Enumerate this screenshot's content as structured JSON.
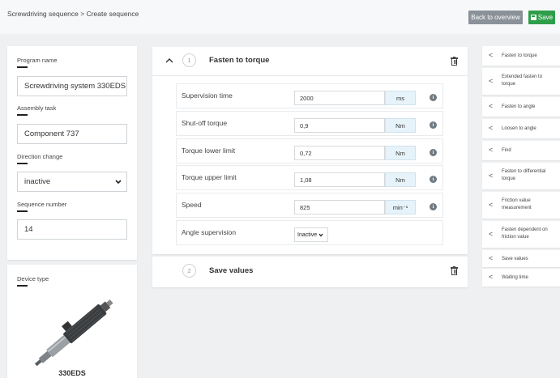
{
  "header": {
    "breadcrumb": "Screwdriving sequence > Create sequence",
    "back_label": "Back to overview",
    "save_label": "Save"
  },
  "program": {
    "program_name_label": "Program name",
    "program_name_value": "Screwdriving system 330EDS",
    "assembly_task_label": "Assembly task",
    "assembly_task_value": "Component 737",
    "direction_change_label": "Direction change",
    "direction_change_value": "inactive",
    "sequence_number_label": "Sequence number",
    "sequence_number_value": "14"
  },
  "device": {
    "label": "Device type",
    "name": "330EDS"
  },
  "steps": [
    {
      "number": "1",
      "title": "Fasten to torque"
    },
    {
      "number": "2",
      "title": "Save values"
    }
  ],
  "params": [
    {
      "label": "Supervision time",
      "value": "2000",
      "unit": "ms"
    },
    {
      "label": "Shut-off torque",
      "value": "0,9",
      "unit": "Nm"
    },
    {
      "label": "Torque lower limit",
      "value": "0,72",
      "unit": "Nm"
    },
    {
      "label": "Torque upper limit",
      "value": "1,08",
      "unit": "Nm"
    },
    {
      "label": "Speed",
      "value": "825",
      "unit": "min⁻¹"
    },
    {
      "label": "Angle supervision",
      "value": "Inactive"
    }
  ],
  "sidebar": {
    "items": [
      {
        "label_lines": [
          "Fasten to torque"
        ]
      },
      {
        "label_lines": [
          "Extended fasten to",
          "torque"
        ]
      },
      {
        "label_lines": [
          "Fasten to angle"
        ]
      },
      {
        "label_lines": [
          "Loosen to angle"
        ]
      },
      {
        "label_lines": [
          "Find"
        ]
      },
      {
        "label_lines": [
          "Fasten to differential",
          "torque"
        ]
      },
      {
        "label_lines": [
          "Friction value",
          "measurement"
        ]
      },
      {
        "label_lines": [
          "Fasten dependent on",
          "friction value"
        ]
      },
      {
        "label_lines": [
          "Save values"
        ]
      },
      {
        "label_lines": [
          "Waiting time"
        ]
      }
    ]
  },
  "colors": {
    "save_button": "#2e9e4a",
    "back_button": "#8a9198",
    "unit_background": "#e7f3fa",
    "page_background": "#eef0f2"
  }
}
